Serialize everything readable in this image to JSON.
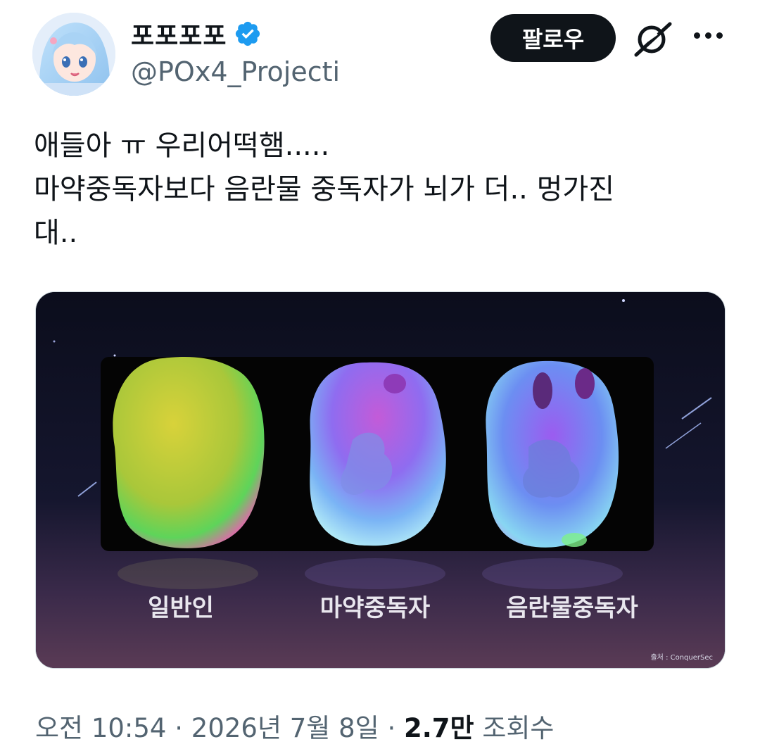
{
  "author": {
    "display_name": "포포포포",
    "handle": "@POx4_Projecti",
    "verified_icon": "verified-badge-icon",
    "avatar": "anime-girl-avatar"
  },
  "actions": {
    "follow_label": "팔로우",
    "grok_icon": "grok-icon",
    "more_icon": "more-options-icon"
  },
  "tweet": {
    "lines": [
      "애들아 ㅠ 우리어떡햄.....",
      "마약중독자보다 음란물 중독자가 뇌가 더.. 멍가진",
      "대.."
    ]
  },
  "media": {
    "labels": [
      "일반인",
      "마약중독자",
      "음란물중독자"
    ],
    "source_credit": "출처 : ConquerSec"
  },
  "meta": {
    "time": "오전 10:54",
    "date": "2026년 7월 8일",
    "sep": "·",
    "views_count": "2.7만",
    "views_label": "조회수"
  }
}
